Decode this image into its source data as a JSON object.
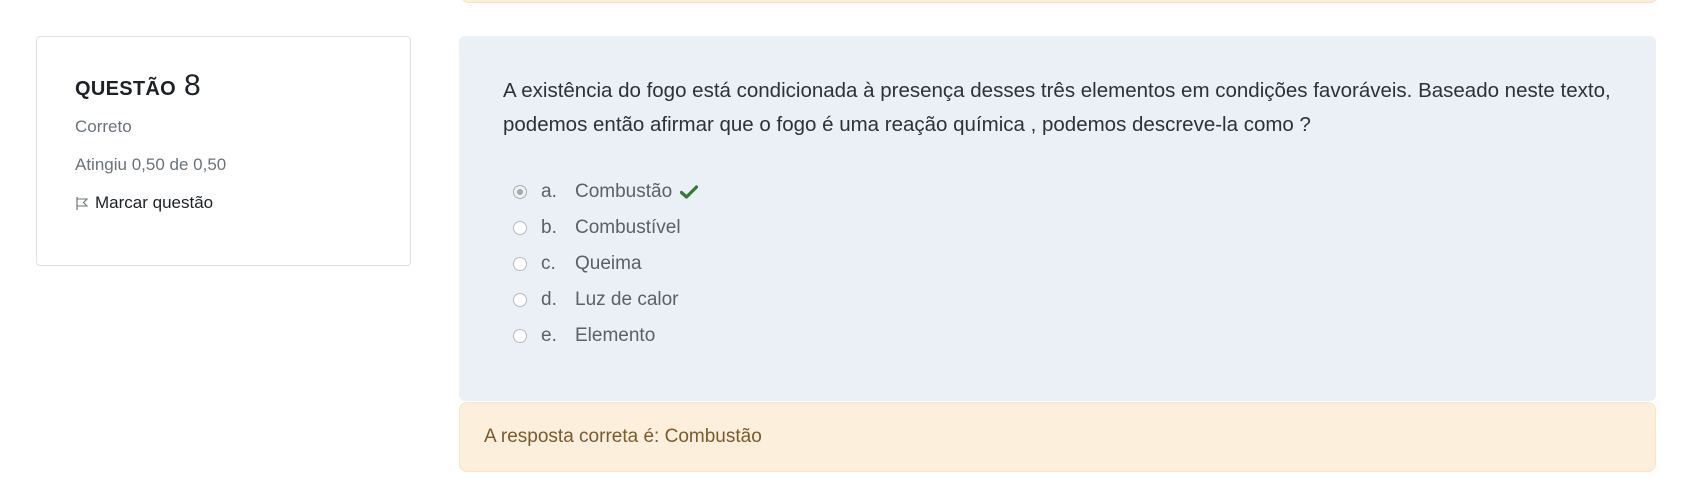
{
  "question_info": {
    "label": "QUESTÃO",
    "number": "8",
    "state": "Correto",
    "grade": "Atingiu 0,50 de 0,50",
    "flag_label": "Marcar questão"
  },
  "question": {
    "text": "A existência do fogo está condicionada à presença desses três elementos em condições favoráveis. Baseado neste texto, podemos então afirmar que o fogo é uma reação química , podemos descreve-la como ?",
    "answers": [
      {
        "letter": "a.",
        "text": "Combustão",
        "selected": true,
        "correct": true
      },
      {
        "letter": "b.",
        "text": "Combustível",
        "selected": false,
        "correct": false
      },
      {
        "letter": "c.",
        "text": "Queima",
        "selected": false,
        "correct": false
      },
      {
        "letter": "d.",
        "text": "Luz de calor",
        "selected": false,
        "correct": false
      },
      {
        "letter": "e.",
        "text": "Elemento",
        "selected": false,
        "correct": false
      }
    ]
  },
  "feedback": {
    "right_answer": "A resposta correta é: Combustão"
  },
  "colors": {
    "correct_check": "#357a32",
    "formulation_bg": "#ebeff6",
    "feedback_bg": "#fcefdc"
  }
}
